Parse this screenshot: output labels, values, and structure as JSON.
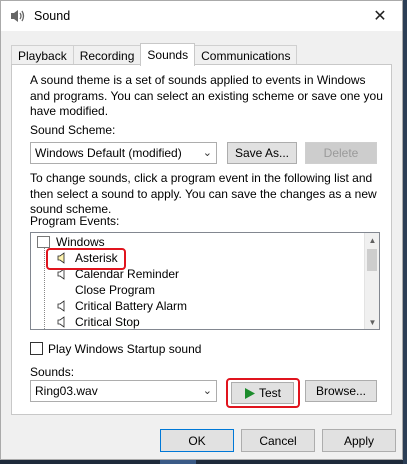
{
  "window": {
    "title": "Sound",
    "close_glyph": "✕"
  },
  "tabs": [
    {
      "label": "Playback"
    },
    {
      "label": "Recording"
    },
    {
      "label": "Sounds",
      "active": true
    },
    {
      "label": "Communications"
    }
  ],
  "sounds_tab": {
    "description": "A sound theme is a set of sounds applied to events in Windows and programs.  You can select an existing scheme or save one you have modified.",
    "scheme_label": "Sound Scheme:",
    "scheme_value": "Windows Default (modified)",
    "save_as_label": "Save As...",
    "delete_label": "Delete",
    "instructions": "To change sounds, click a program event in the following list and then select a sound to apply.  You can save the changes as a new sound scheme.",
    "events_label": "Program Events:",
    "events": [
      {
        "label": "Windows",
        "type": "group"
      },
      {
        "label": "Asterisk",
        "has_sound": true,
        "selected": true
      },
      {
        "label": "Calendar Reminder",
        "has_sound": true
      },
      {
        "label": "Close Program",
        "has_sound": false
      },
      {
        "label": "Critical Battery Alarm",
        "has_sound": true
      },
      {
        "label": "Critical Stop",
        "has_sound": true
      }
    ],
    "startup_label": "Play Windows Startup sound",
    "startup_checked": false,
    "sounds_label": "Sounds:",
    "sound_value": "Ring03.wav",
    "test_label": "Test",
    "browse_label": "Browse..."
  },
  "footer": {
    "ok": "OK",
    "cancel": "Cancel",
    "apply": "Apply"
  },
  "colors": {
    "highlight": "#e0141e",
    "play_icon": "#1c8c2c"
  }
}
